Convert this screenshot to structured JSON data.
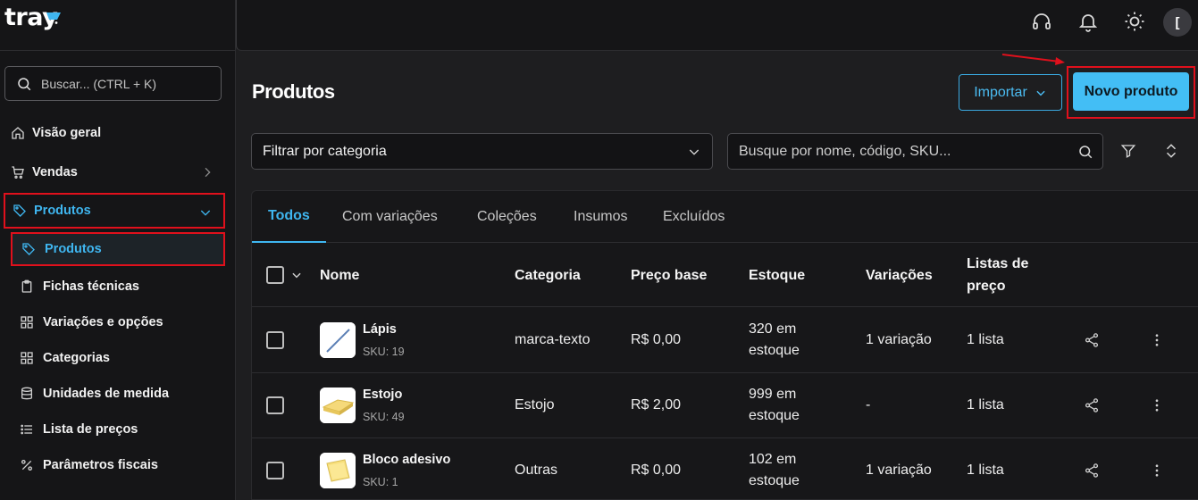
{
  "app": {
    "logo": "tray"
  },
  "sidebar": {
    "search_placeholder": "Buscar... (CTRL + K)",
    "items": [
      {
        "label": "Visão geral",
        "icon": "home-icon"
      },
      {
        "label": "Vendas",
        "icon": "cart-icon"
      },
      {
        "label": "Produtos",
        "icon": "tag-icon"
      }
    ],
    "sub_items": [
      {
        "label": "Produtos",
        "icon": "tag-icon"
      },
      {
        "label": "Fichas técnicas",
        "icon": "clipboard-icon"
      },
      {
        "label": "Variações e opções",
        "icon": "grid-icon"
      },
      {
        "label": "Categorias",
        "icon": "grid-icon"
      },
      {
        "label": "Unidades de medida",
        "icon": "database-icon"
      },
      {
        "label": "Lista de preços",
        "icon": "list-icon"
      },
      {
        "label": "Parâmetros fiscais",
        "icon": "percent-icon"
      }
    ]
  },
  "topbar": {
    "avatar_initial": "["
  },
  "main": {
    "title": "Produtos",
    "import_label": "Importar",
    "new_product_label": "Novo produto",
    "category_filter": "Filtrar por categoria",
    "search_placeholder": "Busque por nome, código, SKU..."
  },
  "tabs": [
    "Todos",
    "Com variações",
    "Coleções",
    "Insumos",
    "Excluídos"
  ],
  "table": {
    "headers": {
      "name": "Nome",
      "category": "Categoria",
      "price": "Preço base",
      "stock": "Estoque",
      "variations": "Variações",
      "price_lists_1": "Listas de",
      "price_lists_2": "preço"
    },
    "rows": [
      {
        "name": "Lápis",
        "sku": "SKU: 19",
        "category": "marca-texto",
        "price": "R$ 0,00",
        "stock_1": "320 em",
        "stock_2": "estoque",
        "variations": "1 variação",
        "lists": "1 lista"
      },
      {
        "name": "Estojo",
        "sku": "SKU: 49",
        "category": "Estojo",
        "price": "R$ 2,00",
        "stock_1": "999 em",
        "stock_2": "estoque",
        "variations": "-",
        "lists": "1 lista"
      },
      {
        "name": "Bloco adesivo",
        "sku": "SKU: 1",
        "category": "Outras",
        "price": "R$ 0,00",
        "stock_1": "102 em",
        "stock_2": "estoque",
        "variations": "1 variação",
        "lists": "1 lista"
      }
    ]
  },
  "colors": {
    "accent": "#43bef5",
    "highlight": "#e0101c",
    "background": "#1e1e20",
    "sidebar": "#151517"
  }
}
